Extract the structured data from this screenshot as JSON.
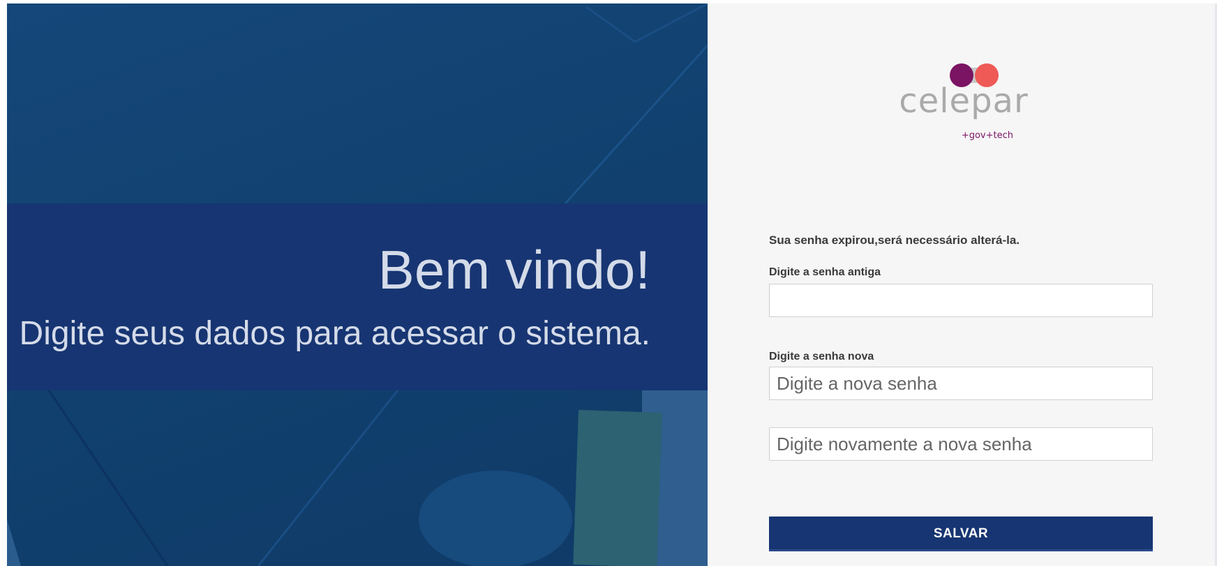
{
  "hero": {
    "welcome": "Bem vindo!",
    "subtitle": "Digite seus dados para acessar o sistema."
  },
  "logo": {
    "name": "celepar",
    "tagline": "+gov+tech"
  },
  "form": {
    "notice": "Sua senha expirou,será necessário alterá-la.",
    "old_password_label": "Digite a senha antiga",
    "old_password_value": "",
    "new_password_label": "Digite a senha nova",
    "new_password_placeholder": "Digite a nova senha",
    "confirm_password_placeholder": "Digite novamente a nova senha",
    "save_label": "SALVAR"
  },
  "colors": {
    "brand_navy": "#173572",
    "logo_purple": "#7b1463",
    "logo_coral": "#ef5a56"
  }
}
